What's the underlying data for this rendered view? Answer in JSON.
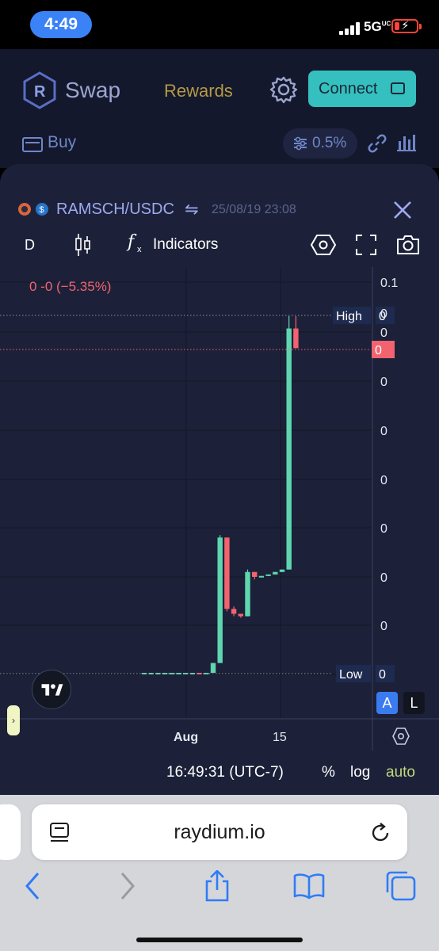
{
  "status_bar": {
    "time": "4:49",
    "network": "5G",
    "network_sup": "UC",
    "battery_low": true
  },
  "header": {
    "brand": "Swap",
    "rewards": "Rewards",
    "connect": "Connect",
    "buy": "Buy",
    "slippage": "0.5%"
  },
  "chart_panel": {
    "pair": "RAMSCH/USDC",
    "swap_symbol": "⇋",
    "datetime": "25/08/19 23:08",
    "interval": "D",
    "fx_symbol": "f",
    "fx_sub": "x",
    "indicators": "Indicators",
    "legend": "0  -0 (−5.35%)",
    "tv_logo": "17",
    "expand": "›",
    "scale_mode_a": "A",
    "scale_mode_l": "L",
    "footer": {
      "clock": "16:49:31 (UTC-7)",
      "percent": "%",
      "log": "log",
      "auto": "auto"
    }
  },
  "chart_data": {
    "type": "candlestick",
    "price_axis_labels": [
      "0.1",
      "0",
      "0",
      "0",
      "0",
      "0",
      "0",
      "0",
      "0",
      "0"
    ],
    "time_axis_labels": [
      "Aug",
      "15"
    ],
    "high_label": "High",
    "high_value": "0",
    "low_label": "Low",
    "low_value": "0",
    "last_price_label": "0",
    "last_change_percent": -5.35,
    "colors": {
      "up": "#5fd6b0",
      "down": "#f2636f",
      "background": "#1c2139",
      "grid": "#131722"
    },
    "candles": [
      {
        "dir": "flat",
        "o": 0.0,
        "c": 0.0,
        "h": 0.0,
        "l": 0.0
      },
      {
        "dir": "flat",
        "o": 0.0,
        "c": 0.0,
        "h": 0.0,
        "l": 0.0
      },
      {
        "dir": "flat",
        "o": 0.0,
        "c": 0.0,
        "h": 0.0,
        "l": 0.0
      },
      {
        "dir": "flat",
        "o": 0.0,
        "c": 0.0,
        "h": 0.0,
        "l": 0.0
      },
      {
        "dir": "flat",
        "o": 0.0,
        "c": 0.0,
        "h": 0.0,
        "l": 0.0
      },
      {
        "dir": "flat",
        "o": 0.0,
        "c": 0.0,
        "h": 0.0,
        "l": 0.0
      },
      {
        "dir": "flat",
        "o": 0.0,
        "c": 0.0,
        "h": 0.0,
        "l": 0.0
      },
      {
        "dir": "flat",
        "o": 0.0,
        "c": 0.0,
        "h": 0.0,
        "l": 0.0
      },
      {
        "dir": "down",
        "o": 0.0,
        "c": 0.0,
        "h": 0.0,
        "l": 0.0
      },
      {
        "dir": "flat",
        "o": 0.0,
        "c": 0.0,
        "h": 0.0,
        "l": 0.0
      },
      {
        "dir": "up",
        "o": 0.0,
        "c": 0.2,
        "h": 0.2,
        "l": 0.0
      },
      {
        "dir": "up",
        "o": 0.2,
        "c": 2.75,
        "h": 2.8,
        "l": 0.2
      },
      {
        "dir": "down",
        "o": 2.75,
        "c": 1.3,
        "h": 2.75,
        "l": 1.25
      },
      {
        "dir": "down",
        "o": 1.3,
        "c": 1.2,
        "h": 1.35,
        "l": 1.15
      },
      {
        "dir": "down",
        "o": 1.2,
        "c": 1.15,
        "h": 1.2,
        "l": 1.12
      },
      {
        "dir": "up",
        "o": 1.15,
        "c": 2.05,
        "h": 2.1,
        "l": 1.15
      },
      {
        "dir": "down",
        "o": 2.05,
        "c": 1.95,
        "h": 2.05,
        "l": 1.9
      },
      {
        "dir": "flat",
        "o": 1.95,
        "c": 1.97,
        "h": 1.97,
        "l": 1.95
      },
      {
        "dir": "up",
        "o": 1.97,
        "c": 2.0,
        "h": 2.0,
        "l": 1.97
      },
      {
        "dir": "up",
        "o": 2.0,
        "c": 2.05,
        "h": 2.05,
        "l": 2.0
      },
      {
        "dir": "up",
        "o": 2.05,
        "c": 2.1,
        "h": 2.1,
        "l": 2.05
      },
      {
        "dir": "up",
        "o": 2.1,
        "c": 7.0,
        "h": 7.25,
        "l": 2.1
      },
      {
        "dir": "down",
        "o": 7.0,
        "c": 6.6,
        "h": 7.25,
        "l": 6.6
      }
    ]
  },
  "browser": {
    "url": "raydium.io"
  }
}
